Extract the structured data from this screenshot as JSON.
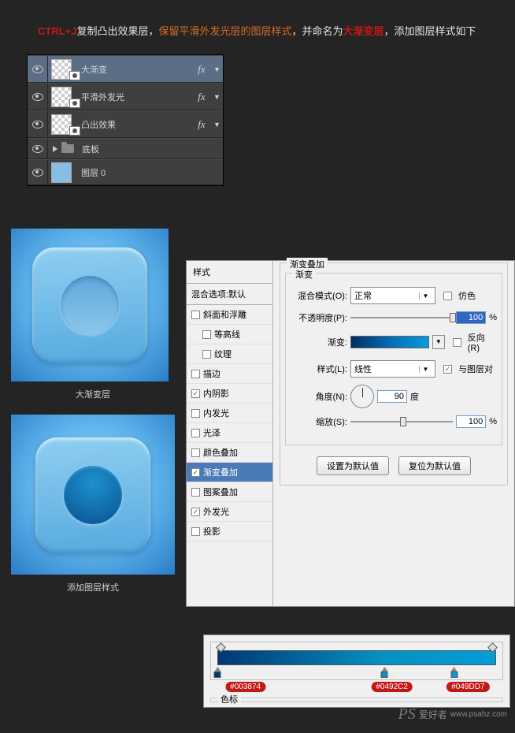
{
  "instruction": {
    "p1a": "CTRL+J",
    "p1b": "复制凸出效果层，",
    "p1c": "保留平滑外发光层的图层样式",
    "p1d": "，并命名为",
    "p1e": "大渐变层",
    "p1f": "，添加图层样式如下"
  },
  "layers": {
    "r1": "大渐变",
    "r2": "平滑外发光",
    "r3": "凸出效果",
    "r4": "底板",
    "r5": "图层 0",
    "fx": "fx"
  },
  "preview": {
    "label1": "大渐变层",
    "label2": "添加图层样式"
  },
  "dialog": {
    "styles_header": "样式",
    "blend_default": "混合选项:默认",
    "items": {
      "bevel": "斜面和浮雕",
      "contour": "等高线",
      "texture": "纹理",
      "stroke": "描边",
      "inner_shadow": "内阴影",
      "inner_glow": "内发光",
      "satin": "光泽",
      "color_overlay": "颜色叠加",
      "grad_overlay": "渐变叠加",
      "pattern_overlay": "图案叠加",
      "outer_glow": "外发光",
      "drop_shadow": "投影"
    },
    "section_title": "渐变叠加",
    "sub_title": "渐变",
    "labels": {
      "blend_mode": "混合模式(O):",
      "opacity": "不透明度(P):",
      "gradient": "渐变:",
      "style": "样式(L):",
      "angle": "角度(N):",
      "scale": "缩放(S):"
    },
    "values": {
      "blend_mode": "正常",
      "opacity": "100",
      "style": "线性",
      "angle": "90",
      "angle_unit": "度",
      "scale": "100"
    },
    "checks": {
      "dither": "仿色",
      "reverse": "反向(R)",
      "align": "与图层对"
    },
    "pct": "%",
    "btn_default": "设置为默认值",
    "btn_reset": "复位为默认值"
  },
  "gradient": {
    "label": "色标",
    "stops": [
      {
        "hex": "#003874",
        "pos": 0
      },
      {
        "hex": "#0492C2",
        "pos": 60
      },
      {
        "hex": "#049DD7",
        "pos": 85
      }
    ]
  },
  "watermark": {
    "brand": "PS",
    "text": "爱好者",
    "url": "www.psahz.com"
  }
}
